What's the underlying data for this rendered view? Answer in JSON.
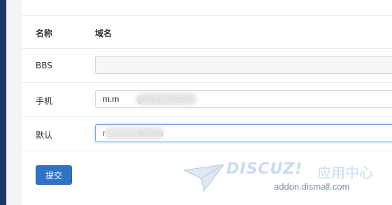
{
  "table": {
    "headers": {
      "name": "名称",
      "domain": "域名"
    },
    "rows": [
      {
        "label": "BBS",
        "value": ""
      },
      {
        "label": "手机",
        "value": "m.m        geopa   n.com"
      },
      {
        "label": "默认",
        "value": "r              ts.com"
      }
    ]
  },
  "form": {
    "submit_label": "提交"
  },
  "watermark": {
    "brand": "DISCUZ!",
    "cn": "应用中心",
    "url": "addon.dismall.com"
  },
  "colors": {
    "accent": "#2f73c7",
    "sidebar": "#1d3a66",
    "focus_border": "#66a6e0"
  }
}
